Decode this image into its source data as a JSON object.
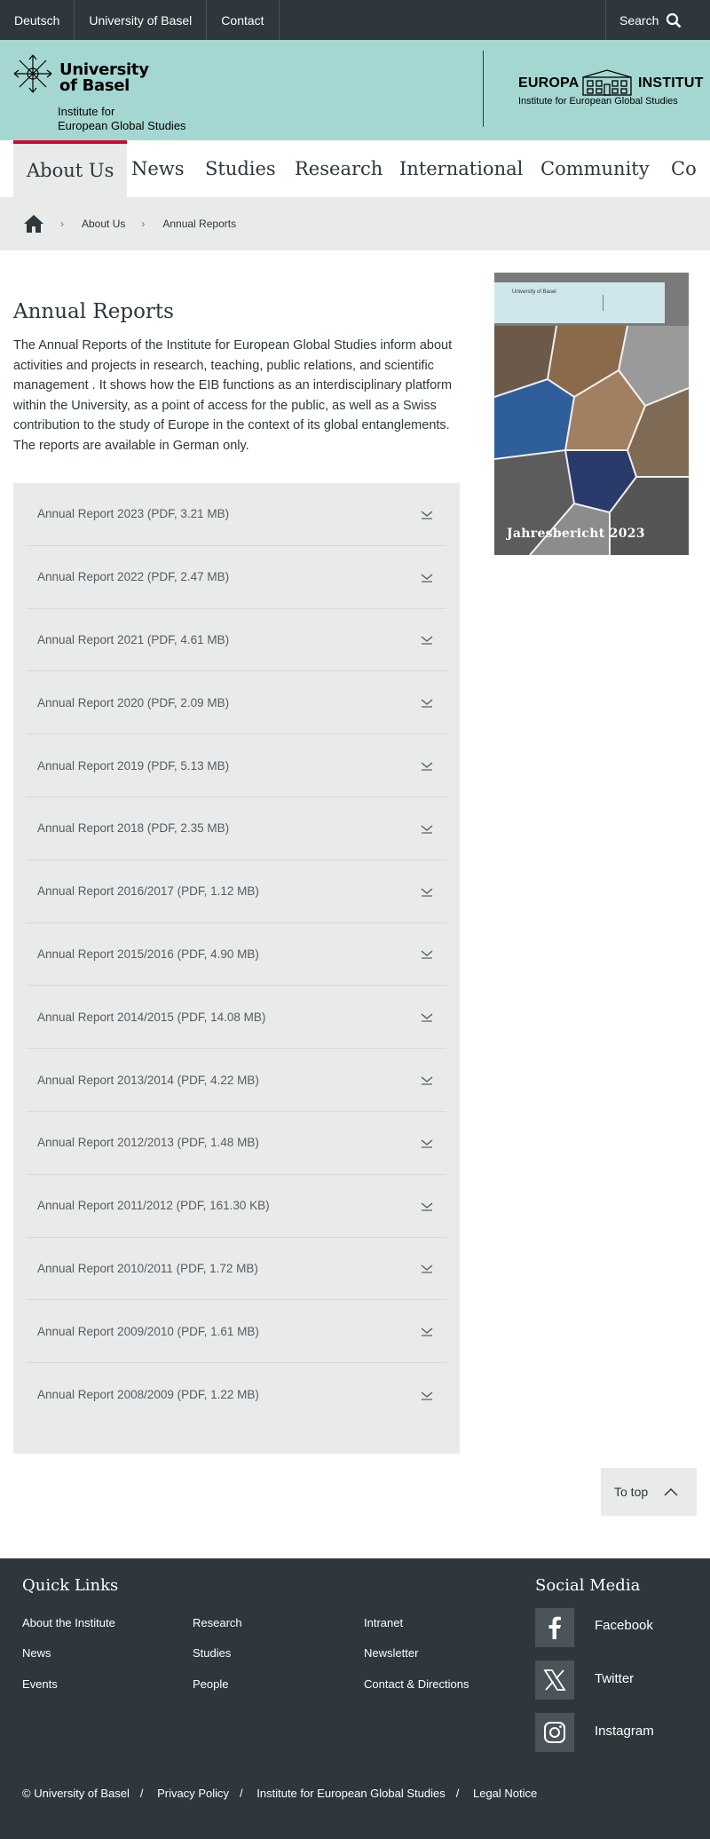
{
  "topbar": {
    "links": [
      "Deutsch",
      "University of Basel",
      "Contact"
    ],
    "search_label": "Search"
  },
  "header": {
    "university_line1": "University",
    "university_line2": "of Basel",
    "institute_line1": "Institute for",
    "institute_line2": "European Global Studies",
    "right_logo_left": "EUROPA",
    "right_logo_right": "INSTITUT",
    "right_logo_sub": "Institute for European Global Studies"
  },
  "nav": {
    "items": [
      "About Us",
      "News",
      "Studies",
      "Research",
      "International",
      "Community",
      "Co"
    ],
    "active": "About Us"
  },
  "breadcrumb": {
    "items": [
      "About Us",
      "Annual Reports"
    ]
  },
  "main": {
    "title": "Annual Reports",
    "intro": "The Annual Reports of the Institute for European Global Studies inform about activities and projects in research, teaching, public relations, and scientific management . It shows how the EIB functions as an interdisciplinary platform within the University, as a point of access for the public, as well as a Swiss contribution to the study of Europe in the context of its global entanglements. The reports are available in German only.",
    "cover_caption": "Jahresbericht 2023",
    "cover_bar_text": "University of Basel",
    "reports": [
      "Annual Report 2023 (PDF, 3.21 MB)",
      "Annual Report 2022 (PDF, 2.47 MB)",
      "Annual Report 2021 (PDF, 4.61 MB)",
      "Annual Report 2020 (PDF, 2.09 MB)",
      "Annual Report 2019 (PDF, 5.13 MB)",
      "Annual Report 2018 (PDF, 2.35 MB)",
      "Annual Report 2016/2017 (PDF, 1.12 MB)",
      "Annual Report 2015/2016 (PDF, 4.90 MB)",
      "Annual Report 2014/2015 (PDF, 14.08 MB)",
      "Annual Report 2013/2014 (PDF, 4.22 MB)",
      "Annual Report 2012/2013 (PDF, 1.48 MB)",
      "Annual Report 2011/2012 (PDF, 161.30 KB)",
      "Annual Report 2010/2011 (PDF, 1.72 MB)",
      "Annual Report 2009/2010 (PDF, 1.61 MB)",
      "Annual Report 2008/2009 (PDF, 1.22 MB)"
    ],
    "to_top": "To top"
  },
  "footer": {
    "quick_links_title": "Quick Links",
    "quick_links": [
      [
        "About the Institute",
        "Research",
        "Intranet"
      ],
      [
        "News",
        "Studies",
        "Newsletter"
      ],
      [
        "Events",
        "People",
        "Contact & Directions"
      ]
    ],
    "social_title": "Social Media",
    "social": [
      {
        "label": "Facebook",
        "icon": "facebook-icon"
      },
      {
        "label": "Twitter",
        "icon": "x-icon"
      },
      {
        "label": "Instagram",
        "icon": "instagram-icon"
      }
    ],
    "legal": [
      "© University of Basel",
      "Privacy Policy",
      "Institute for European Global Studies",
      "Legal Notice"
    ]
  },
  "colors": {
    "topbar_bg": "#2d373c",
    "header_bg": "#a5d7d2",
    "accent_red": "#d20537",
    "panel_bg": "#e9eaea"
  }
}
